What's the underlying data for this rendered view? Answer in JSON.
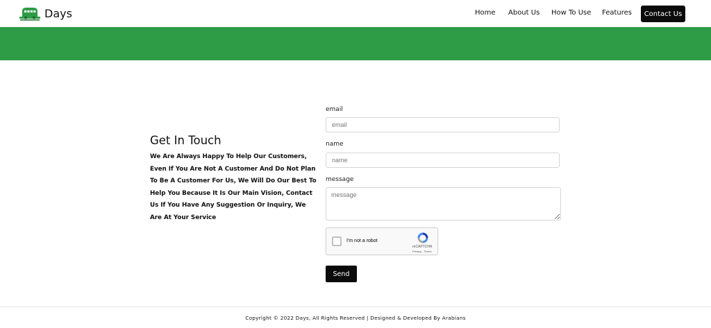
{
  "header": {
    "brand_name": "Days",
    "nav": [
      {
        "label": "Home"
      },
      {
        "label": "About Us"
      },
      {
        "label": "How To Use"
      },
      {
        "label": "Features"
      },
      {
        "label": "Contact Us"
      }
    ]
  },
  "colors": {
    "banner": "#2e9b46",
    "primary_button": "#0b0b0b"
  },
  "intro": {
    "title": "Get In Touch",
    "body": "We Are Always Happy To Help Our Customers, Even If You Are Not A Customer And Do Not Plan To Be A Customer For Us, We Will Do Our Best To Help You Because It Is Our Main Vision, Contact Us If You Have Any Suggestion Or Inquiry, We Are At Your Service"
  },
  "form": {
    "email_label": "email",
    "email_placeholder": "email",
    "email_value": "",
    "name_label": "name",
    "name_placeholder": "name",
    "name_value": "",
    "message_label": "message",
    "message_placeholder": "message",
    "message_value": "",
    "recaptcha_text": "I'm not a robot",
    "recaptcha_brand": "reCAPTCHA",
    "recaptcha_terms": "Privacy - Terms",
    "send_label": "Send"
  },
  "footer": {
    "copyright": "Copyright © 2022 Days, All Rights Reserved | Designed & Developed By Arabians"
  }
}
